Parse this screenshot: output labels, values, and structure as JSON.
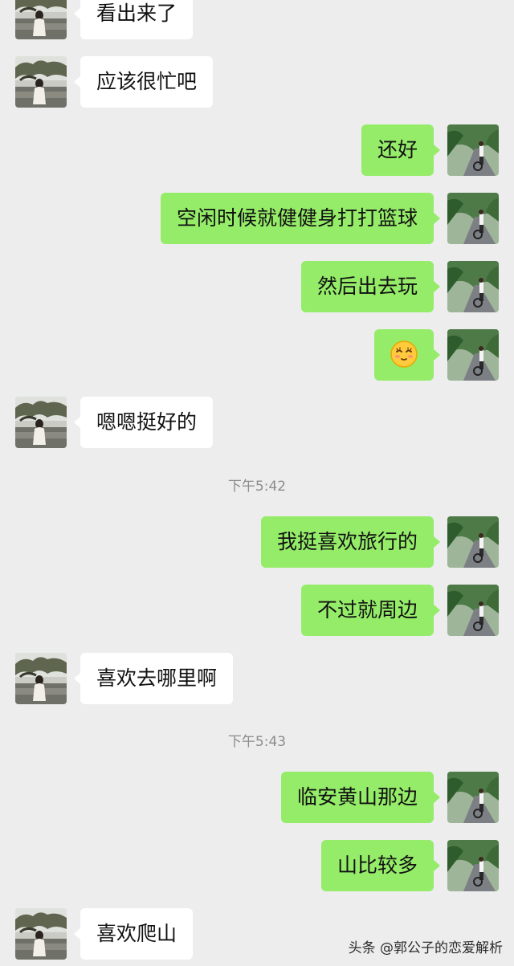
{
  "messages": [
    {
      "side": "in",
      "text": "看出来了"
    },
    {
      "side": "in",
      "text": "应该很忙吧"
    },
    {
      "side": "out",
      "text": "还好"
    },
    {
      "side": "out",
      "text": "空闲时候就健健身打打篮球"
    },
    {
      "side": "out",
      "text": "然后出去玩"
    },
    {
      "side": "out",
      "emoji": "smiling-face-emoji"
    },
    {
      "side": "in",
      "text": "嗯嗯挺好的"
    },
    {
      "timestamp": "下午5:42"
    },
    {
      "side": "out",
      "text": "我挺喜欢旅行的"
    },
    {
      "side": "out",
      "text": "不过就周边"
    },
    {
      "side": "in",
      "text": "喜欢去哪里啊"
    },
    {
      "timestamp": "下午5:43"
    },
    {
      "side": "out",
      "text": "临安黄山那边"
    },
    {
      "side": "out",
      "text": "山比较多"
    },
    {
      "side": "in",
      "text": "喜欢爬山"
    }
  ],
  "watermark": "头条 @郭公子的恋爱解析"
}
